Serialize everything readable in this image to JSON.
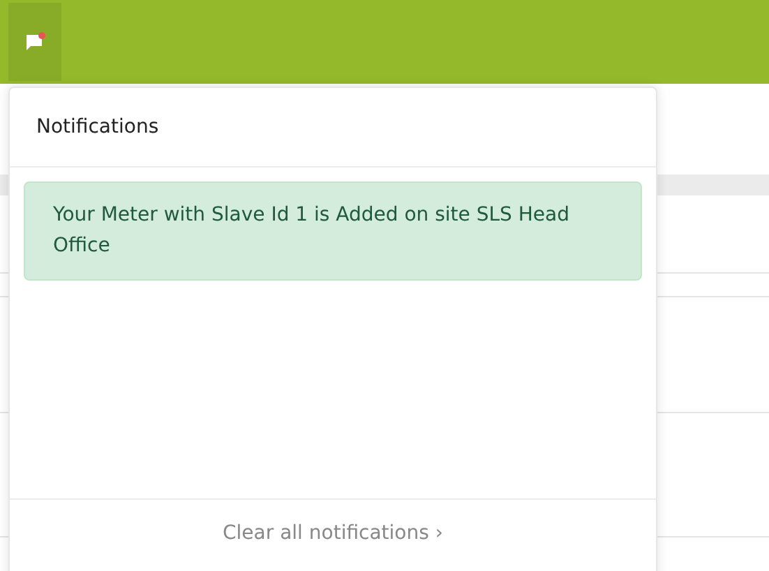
{
  "header": {
    "notification_button": {
      "unread": true
    }
  },
  "notifications_panel": {
    "title": "Notifications",
    "items": [
      {
        "message": "Your Meter with Slave Id 1 is Added on site SLS Head Office"
      }
    ],
    "footer_link": "Clear all notifications ›"
  }
}
